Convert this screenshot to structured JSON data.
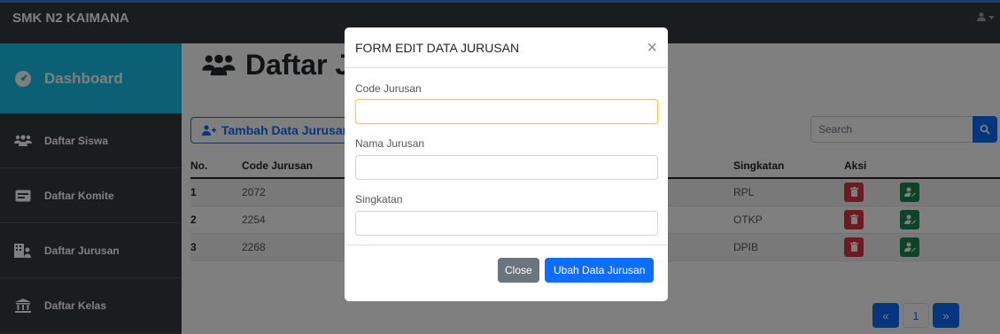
{
  "app": {
    "brand": "SMK N2 KAIMANA"
  },
  "sidebar": {
    "items": [
      {
        "label": "Dashboard",
        "icon": "dashboard-icon"
      },
      {
        "label": "Daftar Siswa",
        "icon": "users-icon"
      },
      {
        "label": "Daftar Komite",
        "icon": "id-card-icon"
      },
      {
        "label": "Daftar Jurusan",
        "icon": "building-icon"
      },
      {
        "label": "Daftar Kelas",
        "icon": "institution-icon"
      }
    ]
  },
  "main": {
    "title": "Daftar Jurusan",
    "add_button": "Tambah Data Jurusan",
    "search_placeholder": "Search",
    "table": {
      "headers": [
        "No.",
        "Code Jurusan",
        "Singkatan",
        "Aksi"
      ],
      "rows": [
        {
          "no": "1",
          "code": "2072",
          "singkatan": "RPL"
        },
        {
          "no": "2",
          "code": "2254",
          "singkatan": "OTKP"
        },
        {
          "no": "3",
          "code": "2268",
          "singkatan": "DPIB"
        }
      ]
    },
    "pager": {
      "prev": "«",
      "page": "1",
      "next": "»"
    }
  },
  "modal": {
    "title": "FORM EDIT DATA JURUSAN",
    "close_glyph": "×",
    "fields": [
      {
        "label": "Code Jurusan",
        "value": ""
      },
      {
        "label": "Nama Jurusan",
        "value": ""
      },
      {
        "label": "Singkatan",
        "value": ""
      }
    ],
    "close_button": "Close",
    "submit_button": "Ubah Data Jurusan"
  },
  "colors": {
    "accent": "#17c1e8",
    "primary": "#0d6efd",
    "danger": "#dc3545",
    "success": "#198754",
    "sidebar": "#343a40"
  }
}
